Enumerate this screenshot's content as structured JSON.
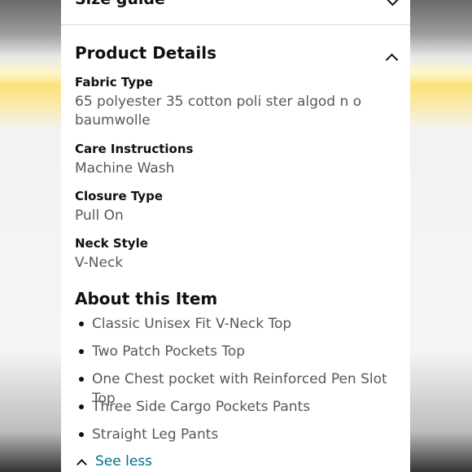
{
  "size_guide": {
    "label": "Size guide"
  },
  "product_details": {
    "title": "Product Details",
    "items": [
      {
        "label": "Fabric Type",
        "value": "65 polyester 35 cotton poli ster algod n o baumwolle"
      },
      {
        "label": "Care Instructions",
        "value": "Machine Wash"
      },
      {
        "label": "Closure Type",
        "value": "Pull On"
      },
      {
        "label": "Neck Style",
        "value": "V-Neck"
      }
    ]
  },
  "about": {
    "title": "About this Item",
    "bullets": [
      "Classic Unisex Fit V-Neck Top",
      "Two Patch Pockets Top",
      "One Chest pocket with Reinforced Pen Slot Top",
      "Three Side Cargo Pockets Pants",
      "Straight Leg Pants"
    ],
    "see_less_label": "See less"
  },
  "colors": {
    "link": "#007185",
    "text": "#0f1111",
    "muted": "#565959",
    "divider": "#d5d9d9"
  }
}
